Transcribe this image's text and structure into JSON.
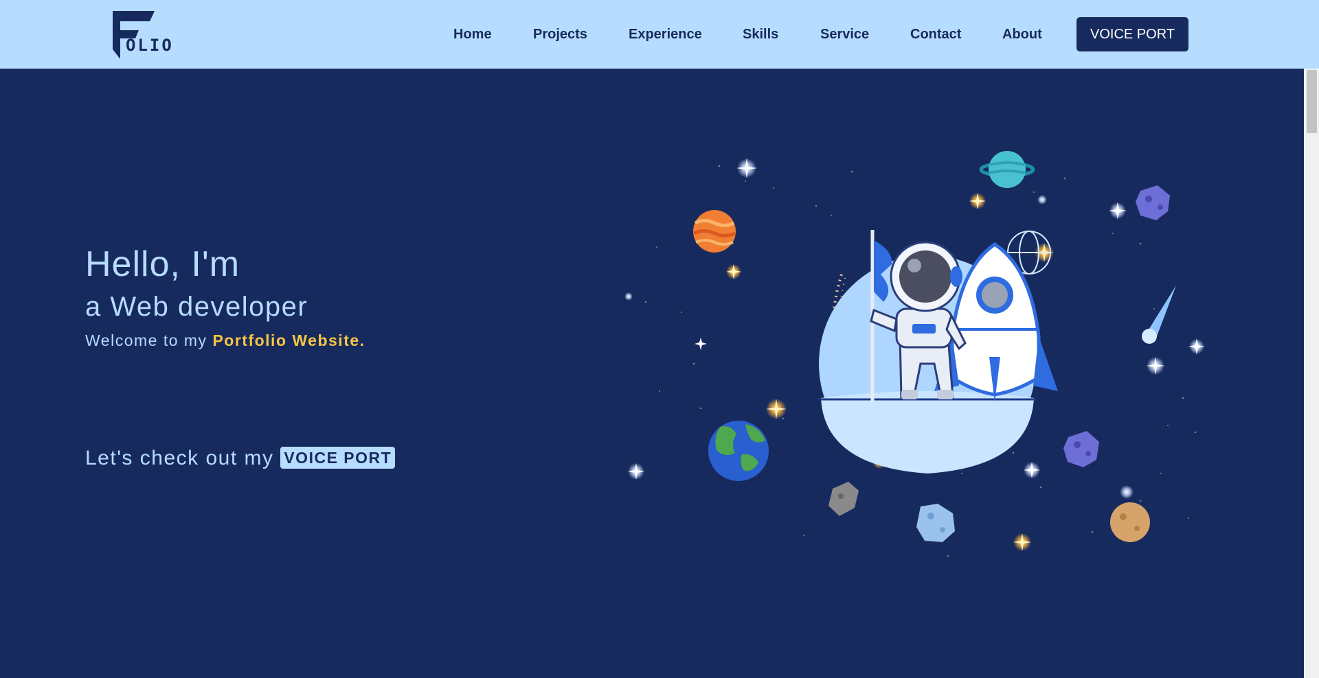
{
  "brand": {
    "logo_text": "OLIO"
  },
  "nav": {
    "links": [
      "Home",
      "Projects",
      "Experience",
      "Skills",
      "Service",
      "Contact",
      "About"
    ],
    "cta_label": "VOICE PORT"
  },
  "hero": {
    "greeting": "Hello, I'm",
    "role": "a Web developer",
    "welcome_prefix": "Welcome to my",
    "welcome_highlight": "Portfolio Website.",
    "cta_prefix": "Let's check out my",
    "cta_badge": "VOICE PORT"
  },
  "colors": {
    "navbar_bg": "#b6dcfe",
    "page_bg": "#172a5e",
    "accent_text": "#b6dcfe",
    "highlight": "#f6c544",
    "button_bg": "#172a5e"
  }
}
